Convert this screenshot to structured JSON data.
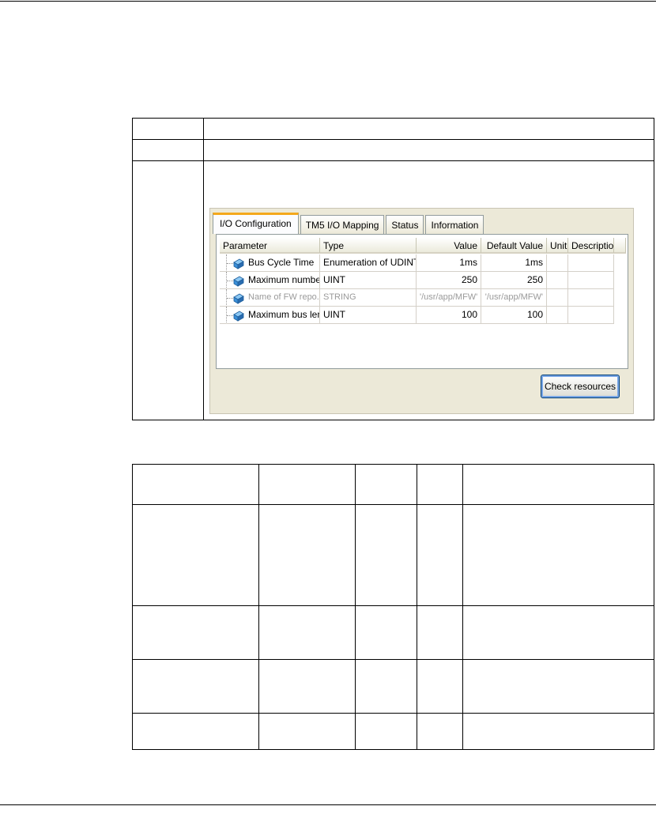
{
  "config_panel": {
    "tabs": [
      {
        "label": "I/O Configuration",
        "active": true
      },
      {
        "label": "TM5 I/O Mapping",
        "active": false
      },
      {
        "label": "Status",
        "active": false
      },
      {
        "label": "Information",
        "active": false
      }
    ],
    "columns": {
      "parameter": "Parameter",
      "type": "Type",
      "value": "Value",
      "default_value": "Default Value",
      "unit": "Unit",
      "description": "Description"
    },
    "rows": [
      {
        "parameter": "Bus Cycle Time",
        "type": "Enumeration of UDINT",
        "value": "1ms",
        "default_value": "1ms",
        "unit": "",
        "description": "",
        "enabled": true,
        "icon": "parameter-icon"
      },
      {
        "parameter": "Maximum number...",
        "type": "UINT",
        "value": "250",
        "default_value": "250",
        "unit": "",
        "description": "",
        "enabled": true,
        "icon": "parameter-icon"
      },
      {
        "parameter": "Name of FW repo...",
        "type": "STRING",
        "value": "'/usr/app/MFW'",
        "default_value": "'/usr/app/MFW'",
        "unit": "",
        "description": "",
        "enabled": false,
        "icon": "parameter-icon"
      },
      {
        "parameter": "Maximum bus len...",
        "type": "UINT",
        "value": "100",
        "default_value": "100",
        "unit": "",
        "description": "",
        "enabled": true,
        "icon": "parameter-icon"
      }
    ],
    "check_button_label": "Check resources",
    "colors": {
      "active_tab_accent": "#f4a81c",
      "panel_bg": "#ece9d8",
      "icon_blue": "#3a8fd8"
    }
  }
}
